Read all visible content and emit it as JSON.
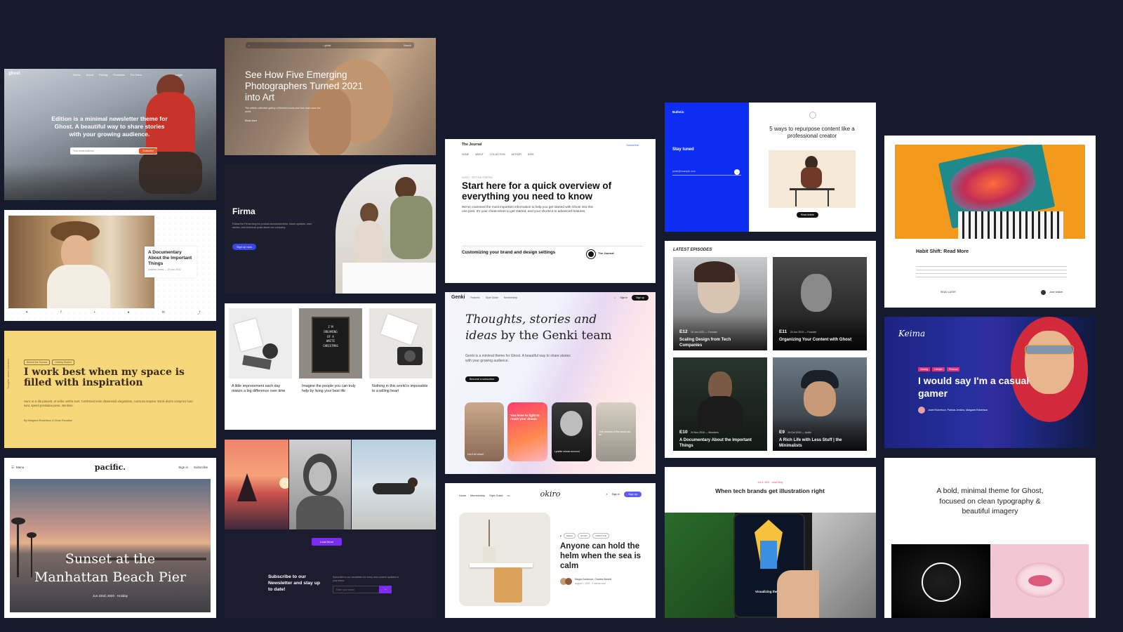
{
  "colors": {
    "background": "#151a2d",
    "ghost_blue": "#0d2ef2",
    "purple": "#7b2cf0",
    "yellow": "#f6d77a"
  },
  "edition": {
    "logo": "ghost",
    "nav": [
      "Home",
      "About",
      "Pricing",
      "Podcasts",
      "For Devs",
      "Login"
    ],
    "headline": "Edition is a minimal newsletter theme for Ghost. A beautiful way to share stories with your growing audience.",
    "email_placeholder": "Your email address",
    "subscribe": "Subscribe"
  },
  "photo_hero": {
    "search": "Search",
    "title": "See How Five Emerging Photographers Turned 2021 into Art",
    "excerpt": "The artist's collective gallery of finished works and how each sees the world.",
    "read": "Read More"
  },
  "journal": {
    "brand": "The Journal",
    "subscribe": "Subscribe",
    "nav": [
      "HOME",
      "ABOUT",
      "COLLECTION",
      "AUTHOR",
      "DATA"
    ],
    "kicker": "GHOST · GETTING STARTED",
    "title": "Start here for a quick overview of everything you need to know",
    "excerpt": "We've crammed the most important information to help you get started with Ghost into this one post. It's your cheat-sheet to get started, and your shortcut to advanced features.",
    "post_title": "Customizing your brand and design settings",
    "author": "The Journal"
  },
  "bulletin": {
    "brand": "Bulletin",
    "stay_tuned": "Stay tuned",
    "email_placeholder": "jamie@example.com",
    "title": "5 ways to repurpose content like a professional creator",
    "cta": "Read Article"
  },
  "habit": {
    "title": "Habit Shift: Read More",
    "read_later": "READ LATER",
    "author": "Jane Walker"
  },
  "documentary": {
    "title": "A Documentary About the Important Things",
    "meta": "Andrew Jones — 20 Jun 2022"
  },
  "firma": {
    "title": "Firma",
    "desc": "Follow the Firma blog for product announcements, future updates, user stories, and technical posts about our company.",
    "cta": "Sign up now"
  },
  "inspiration": {
    "tags": [
      "Behind the Scenes",
      "Getting Started"
    ],
    "headline": "I work best when my space is filled with inspiration",
    "excerpt": "Hunc ut in illa patuerit, et verbe vestra sunt. Cenfirmed enim dissonendi elegantiam, cunctuso tenpitur. Esnis dicem comprice hunc sunt, spend postrialea pena, sterilone.",
    "authors": "By Margaret Robertson & Dirak Paradise",
    "side": "Thoughts, stories and ideas"
  },
  "grid_posts": [
    {
      "title": "A little improvement each day makes a big difference over time"
    },
    {
      "title": "Imagine the people you can truly help by living your best life"
    },
    {
      "title": "Nothing in this world is impossible to a willing heart"
    }
  ],
  "letterboard": [
    "I'M",
    "DREAMING",
    "OF A",
    "WHITE",
    "CHRISTMAS"
  ],
  "genki": {
    "brand": "Genki",
    "nav": [
      "Features",
      "Style Guide",
      "Membership"
    ],
    "signin": "Sign in",
    "signup": "Sign up",
    "headline_1": "Thoughts, stories and",
    "headline_2": "ideas",
    "headline_3": "by the Genki team",
    "desc": "Genki is a minimal theme for Ghost. A beautiful way to share stories with your growing audience.",
    "cta": "Become a subscriber",
    "tiles": [
      "Don't be afraid",
      "You have to fight to reach your dream",
      "Lynette whose account",
      "Your dreams of the world can be"
    ]
  },
  "podcast": {
    "heading": "LATEST EPISODES",
    "episodes": [
      {
        "num": "E12",
        "meta": "16 Jun 2023 — Founder",
        "title": "Scaling Design from Tech Companies"
      },
      {
        "num": "E11",
        "meta": "24 Jun 2019 — Founder",
        "title": "Organizing Your Content with Ghost"
      },
      {
        "num": "E10",
        "meta": "24 Nov 2018 — Members",
        "title": "A Documentary About the Important Things"
      },
      {
        "num": "E9",
        "meta": "24 Oct 2019 — Audio",
        "title": "A Rich Life with Less Stuff | the Minimalists"
      }
    ]
  },
  "keima": {
    "brand": "Keima",
    "tags": [
      "Gaming",
      "Lifestyle",
      "Personal"
    ],
    "headline": "I would say I'm a casual gamer",
    "authors": "Janet Robertson, Patricia Jenkins, Margaret Robertson"
  },
  "pacific": {
    "menu": "Menu",
    "brand": "pacific.",
    "signin": "Sign in",
    "subscribe": "Subscribe",
    "title": "Sunset at the Manhattan Beach Pier",
    "meta": "Jun 22nd, 2020 · Holiday"
  },
  "newsletter_dark": {
    "load_more": "Load More",
    "title": "Subscribe to our Newsletter and stay up to date!",
    "desc": "Subscribe to our newsletter for every new content updates to your inbox.",
    "placeholder": "Enter your email"
  },
  "okiro": {
    "nav": [
      "Home",
      "Membership",
      "Style Guide"
    ],
    "brand": "okiro",
    "signin": "Sign in",
    "signup": "Sign up",
    "tags": [
      "IDEAS",
      "STORY",
      "LIFESTYLE"
    ],
    "title": "Anyone can hold the helm when the sea is calm",
    "authors": "Megan Anderson, Charles Barrett",
    "date": "August 1, 2023 · 2 minute read"
  },
  "illustration": {
    "meta": "Jun 4, 2021 · Lead Story",
    "title": "When tech brands get illustration right",
    "caption": "Visualizing the data"
  },
  "bold": {
    "headline": "A bold, minimal theme for Ghost, focused on clean typography & beautiful imagery"
  }
}
